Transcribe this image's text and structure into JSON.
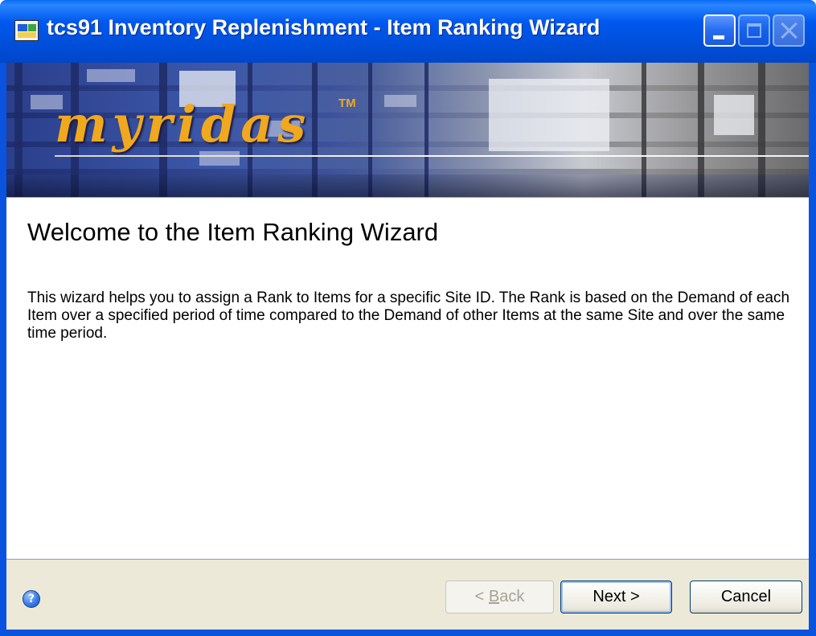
{
  "window": {
    "title": "tcs91 Inventory Replenishment - Item Ranking Wizard"
  },
  "banner": {
    "brand": "myridas",
    "trademark": "TM"
  },
  "content": {
    "heading": "Welcome to the Item Ranking Wizard",
    "description": "This wizard helps you to assign a Rank to Items for a specific Site ID. The Rank is based on the Demand of each Item over a specified period of time compared to the Demand of other Items at the same Site and over the same time period."
  },
  "footer": {
    "help_icon": "help-icon",
    "back_prefix": "< ",
    "back_mnemonic": "B",
    "back_suffix": "ack",
    "next_label": "Next >",
    "cancel_label": "Cancel"
  }
}
